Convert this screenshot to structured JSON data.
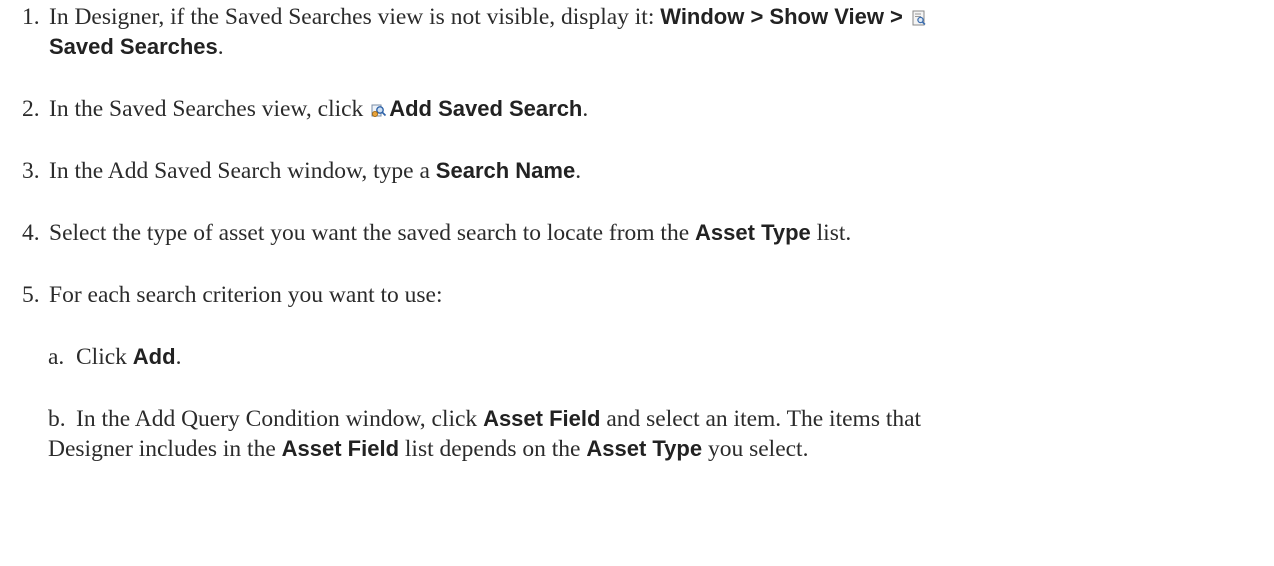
{
  "steps": [
    {
      "num": "1.",
      "l1_a": "In Designer, if the Saved Searches view is not visible, display it: ",
      "l1_b": "Window > Show View > ",
      "l2_a": "Saved Searches",
      "l2_b": "."
    },
    {
      "num": "2.",
      "a": "In the Saved Searches view, click ",
      "b": "Add Saved Search",
      "c": "."
    },
    {
      "num": "3.",
      "a": "In the Add Saved Search window, type a ",
      "b": "Search Name",
      "c": "."
    },
    {
      "num": "4.",
      "a": "Select the type of asset you want the saved search to locate from the ",
      "b": "Asset Type",
      "c": " list."
    },
    {
      "num": "5.",
      "a": "For each search criterion you want to use:"
    }
  ],
  "substeps": [
    {
      "num": "a.",
      "a": "Click ",
      "b": "Add",
      "c": "."
    },
    {
      "num": "b.",
      "l1_a": "In the Add Query Condition window, click ",
      "l1_b": "Asset Field",
      "l1_c": " and select an item. The items that",
      "l2_a": "Designer includes in the ",
      "l2_b": "Asset Field",
      "l2_c": " list depends on the ",
      "l2_d": "Asset Type",
      "l2_e": " you select."
    }
  ],
  "icons": {
    "saved_searches": "saved-searches-icon",
    "add_saved_search": "add-saved-search-icon"
  }
}
